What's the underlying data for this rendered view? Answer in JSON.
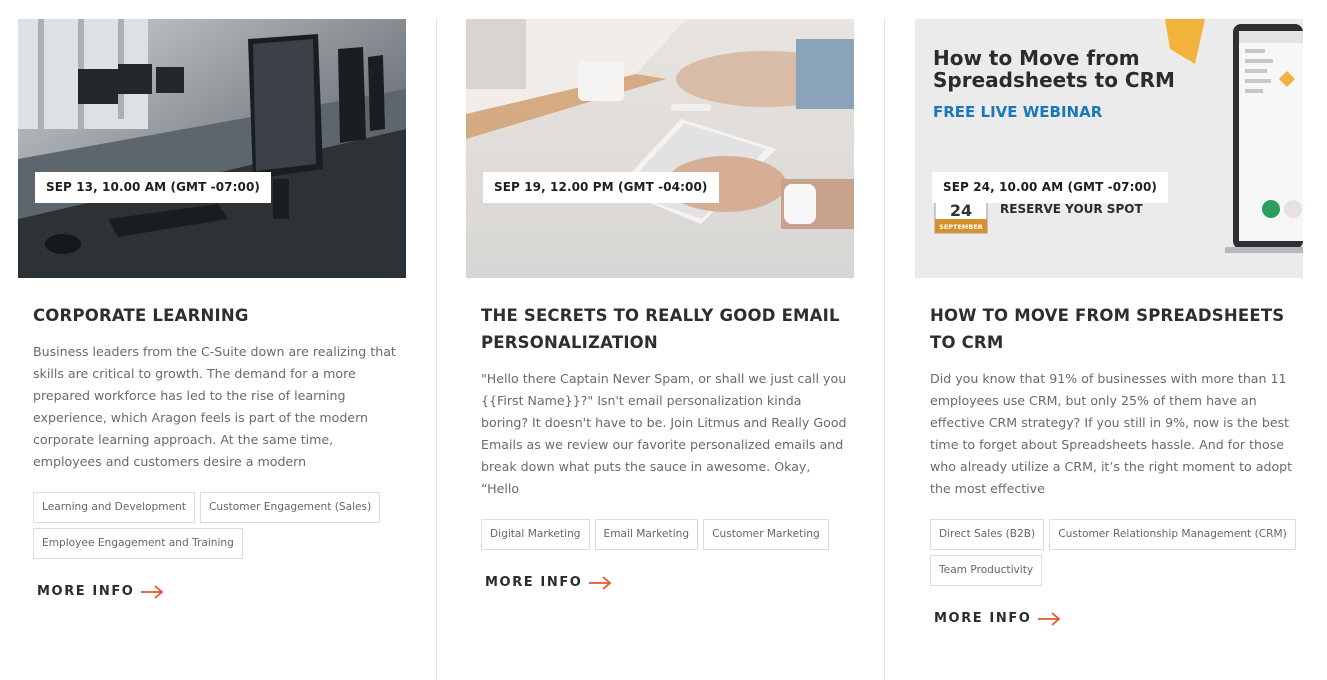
{
  "cards": [
    {
      "date": "SEP 13, 10.00 AM (GMT -07:00)",
      "title": "CORPORATE LEARNING",
      "description": "Business leaders from the C-Suite down are realizing that skills are critical to growth. The demand for a more prepared workforce has led to the rise of learning experience, which Aragon feels is part of the modern corporate learning approach. At the same time, employees and customers desire a modern",
      "tags": [
        "Learning and Development",
        "Customer Engagement (Sales)",
        "Employee Engagement and Training"
      ],
      "more_info": "MORE INFO"
    },
    {
      "date": "SEP 19, 12.00 PM (GMT -04:00)",
      "title": "THE SECRETS TO REALLY GOOD EMAIL PERSONALIZATION",
      "description": "\"Hello there Captain Never Spam, or shall we just call you {{First Name}}?\" Isn't email personalization kinda boring? It doesn't have to be. Join Litmus and Really Good Emails as we review our favorite personalized emails and break down what puts the sauce in awesome. Okay, “Hello",
      "tags": [
        "Digital Marketing",
        "Email Marketing",
        "Customer Marketing"
      ],
      "more_info": "MORE INFO"
    },
    {
      "date": "SEP 24, 10.00 AM (GMT -07:00)",
      "title": "HOW TO MOVE FROM SPREADSHEETS TO CRM",
      "description": "Did you know that 91% of businesses with more than 11 employees use CRM, but only 25% of them have an effective CRM strategy? If you still in 9%, now is the best time to forget about Spreadsheets hassle. And for those who already utilize a CRM, it’s the right moment to adopt the most effective",
      "tags": [
        "Direct Sales (B2B)",
        "Customer Relationship Management (CRM)",
        "Team Productivity"
      ],
      "more_info": "MORE INFO",
      "image_text": {
        "headline_1": "How to Move from",
        "headline_2": "Spreadsheets to CRM",
        "subheadline": "FREE LIVE WEBINAR",
        "cta": "RESERVE YOUR SPOT",
        "calendar_day": "24",
        "calendar_month": "SEPTEMBER"
      }
    }
  ],
  "colors": {
    "accent_arrow": "#e8542f",
    "webinar_blue": "#1a78b8",
    "title_text": "#2e2e2e",
    "body_text": "#6a6a6a"
  },
  "icons": {
    "more_info_arrow": "arrow-right-icon"
  }
}
